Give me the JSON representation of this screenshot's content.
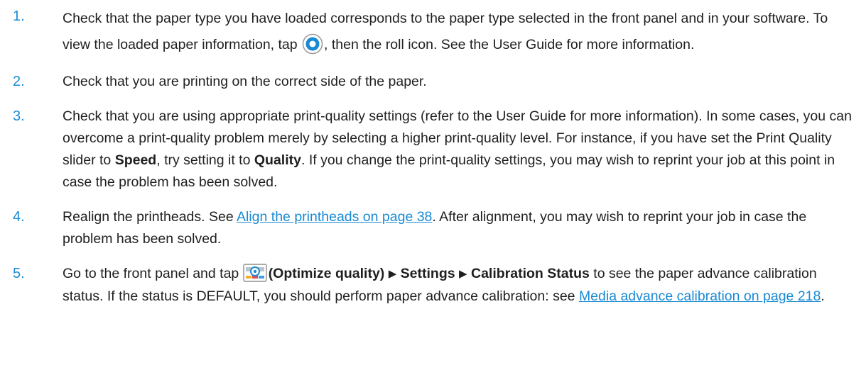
{
  "accent_color": "#1a8ad4",
  "steps": [
    {
      "number": "1.",
      "t1": "Check that the paper type you have loaded corresponds to the paper type selected in the front panel and in your software. To view the loaded paper information, tap",
      "icon": "paper-info-target-icon",
      "t2": ", then the roll icon. See the User Guide for more information."
    },
    {
      "number": "2.",
      "t1": "Check that you are printing on the correct side of the paper."
    },
    {
      "number": "3.",
      "t1": "Check that you are using appropriate print-quality settings (refer to the User Guide for more information). In some cases, you can overcome a print-quality problem merely by selecting a higher print-quality level. For instance, if you have set the Print Quality slider to",
      "b1": "Speed",
      "t2": ", try setting it to",
      "b2": "Quality",
      "t3": ". If you change the print-quality settings, you may wish to reprint your job at this point in case the problem has been solved."
    },
    {
      "number": "4.",
      "t1": "Realign the printheads. See",
      "link": "Align the printheads on page 38",
      "t2": ". After alignment, you may wish to reprint your job in case the problem has been solved."
    },
    {
      "number": "5.",
      "t1": "Go to the front panel and tap",
      "icon": "optimize-quality-icon",
      "b1": "(Optimize quality)",
      "arrow": "▶",
      "b2": "Settings",
      "b3": "Calibration Status",
      "t2": "to see the paper advance calibration status. If the status is DEFAULT, you should perform paper advance calibration: see",
      "link": "Media advance calibration on page 218",
      "t3": "."
    }
  ]
}
